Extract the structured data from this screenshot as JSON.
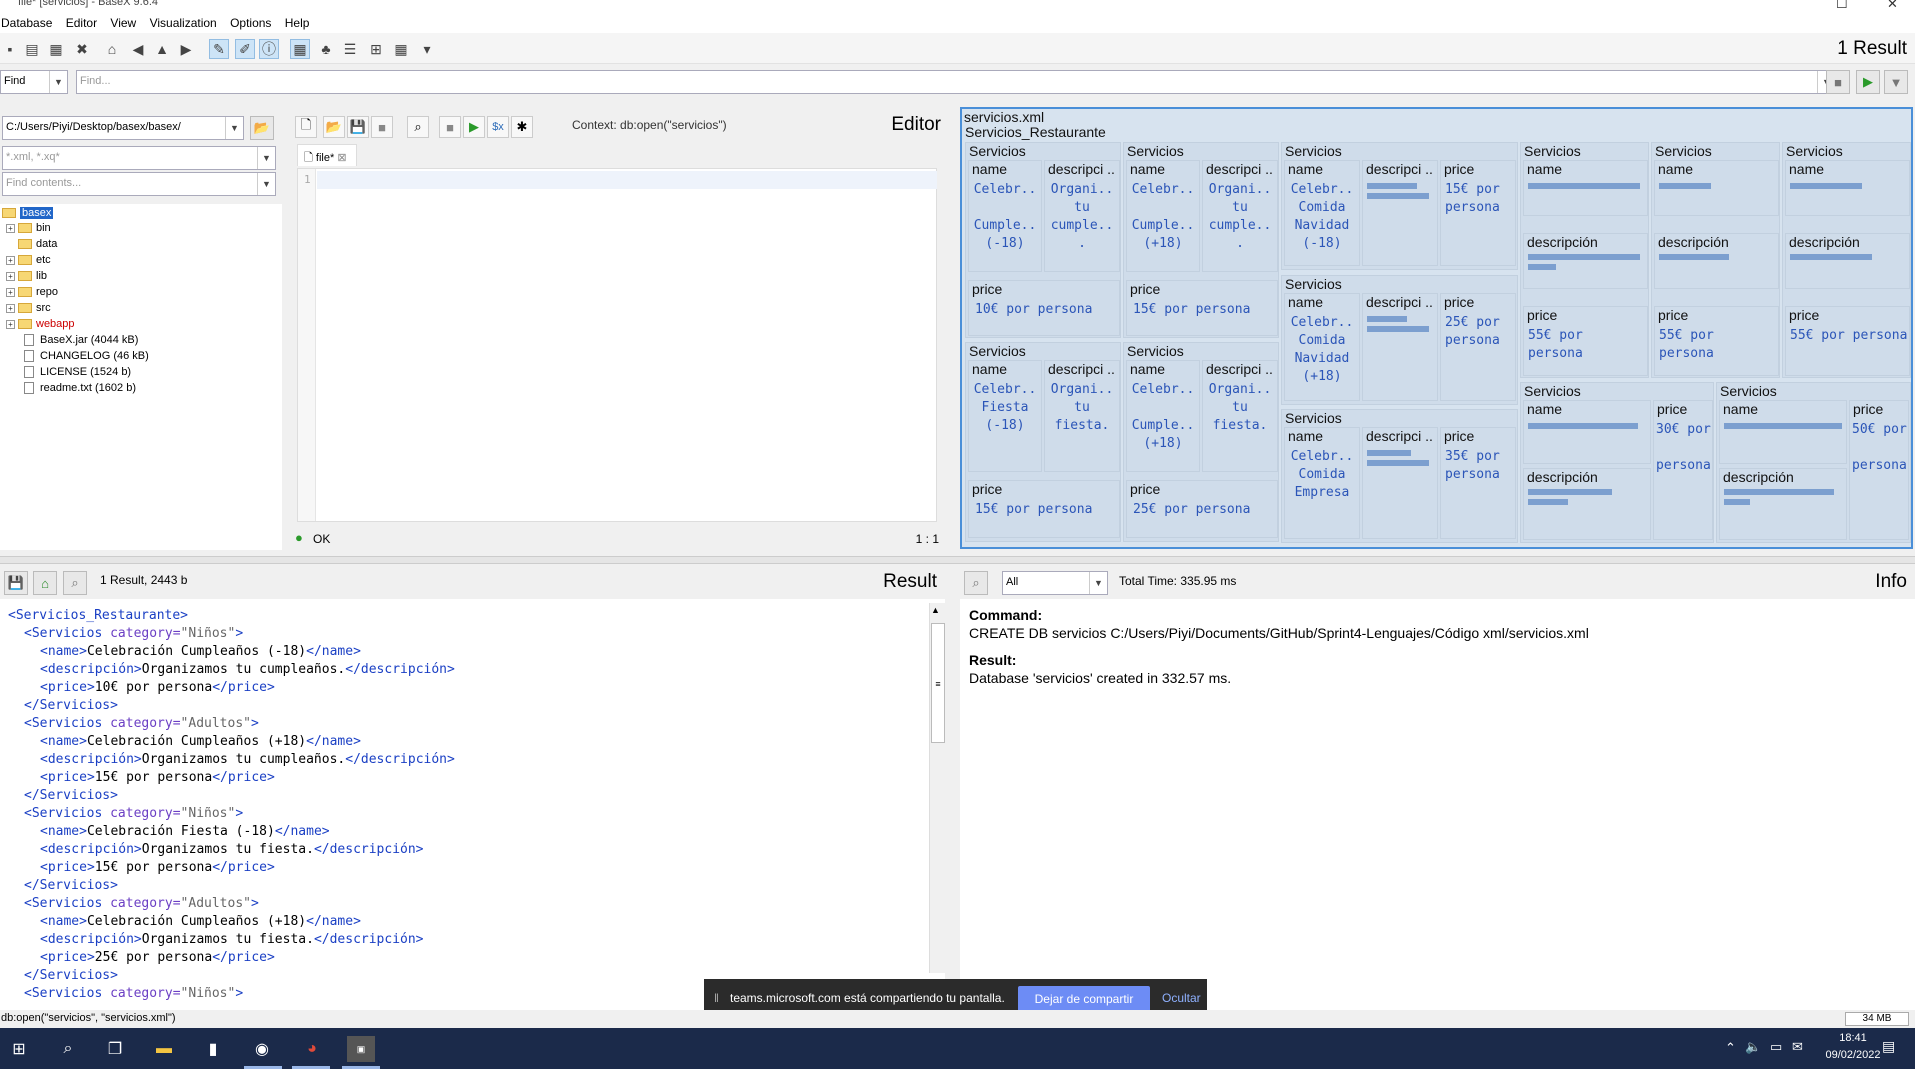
{
  "window": {
    "title": "file* [servicios] - BaseX 9.6.4"
  },
  "menu": [
    "Database",
    "Editor",
    "View",
    "Visualization",
    "Options",
    "Help"
  ],
  "toolbar": {
    "icons": [
      "new-db-icon",
      "open-db-icon",
      "properties-icon",
      "close-icon",
      "home-icon",
      "back-icon",
      "up-icon",
      "forward-icon",
      "filter-icon",
      "xquery-icon",
      "info-icon",
      "map-icon",
      "tree-icon",
      "folder-icon",
      "plot-icon",
      "table-icon",
      "more-icon"
    ],
    "result_count": "1 Result"
  },
  "find": {
    "mode": "Find",
    "placeholder": "Find..."
  },
  "project": {
    "path": "C:/Users/Piyi/Desktop/basex/basex/",
    "filter_placeholder": "*.xml, *.xq*",
    "contents_placeholder": "Find contents...",
    "root": "basex",
    "folders": [
      "bin",
      "data",
      "etc",
      "lib",
      "repo",
      "src",
      "webapp"
    ],
    "files": [
      "BaseX.jar (4044 kB)",
      "CHANGELOG (46 kB)",
      "LICENSE (1524 b)",
      "readme.txt (1602 b)"
    ]
  },
  "editor": {
    "context": "Context: db:open(\"servicios\")",
    "title": "Editor",
    "tab": "file*",
    "line": "1",
    "status": "OK",
    "position": "1 : 1"
  },
  "map": {
    "root": "servicios.xml",
    "container": "Servicios_Restaurante",
    "servicios": "Servicios",
    "name": "name",
    "descripcion_short": "descripci ..",
    "descripcion": "descripción",
    "price": "price",
    "items": [
      {
        "name": "Celebr..\n\nCumple..\n(-18)",
        "desc": "Organi..\ntu\ncumple..\n.",
        "price": "10€ por persona"
      },
      {
        "name": "Celebr..\n\nCumple..\n(+18)",
        "desc": "Organi..\ntu\ncumple..\n.",
        "price": "15€ por persona"
      },
      {
        "name": "Celebr..\nFiesta\n(-18)",
        "desc": "Organi..\ntu\nfiesta.",
        "price": "15€ por persona"
      },
      {
        "name": "Celebr..\n\nCumple..\n(+18)",
        "desc": "Organi..\ntu\nfiesta.",
        "price": "25€ por persona"
      },
      {
        "name": "Celebr..\nComida\nNavidad\n(-18)",
        "price": "15€ por\npersona"
      },
      {
        "name": "Celebr..\nComida\nNavidad\n(+18)",
        "price": "25€ por\npersona"
      },
      {
        "name": "Celebr..\nComida\nEmpresa",
        "price": "35€ por\npersona"
      },
      {
        "price": "55€ por\npersona"
      },
      {
        "price": "55€ por\npersona"
      },
      {
        "price": "55€ por persona"
      },
      {
        "price": "30€ por\n\npersona"
      },
      {
        "price": "50€ por\n\npersona"
      }
    ]
  },
  "result": {
    "summary": "1 Result, 2443 b",
    "title": "Result",
    "lines": [
      {
        "i": 0,
        "t": "<Servicios_Restaurante>"
      },
      {
        "i": 1,
        "open": "Servicios",
        "cat": "Niños"
      },
      {
        "i": 2,
        "tag": "name",
        "v": "Celebración Cumpleaños (-18)"
      },
      {
        "i": 2,
        "tag": "descripción",
        "v": "Organizamos tu cumpleaños."
      },
      {
        "i": 2,
        "tag": "price",
        "v": "10€ por persona"
      },
      {
        "i": 1,
        "t": "</Servicios>"
      },
      {
        "i": 1,
        "open": "Servicios",
        "cat": "Adultos"
      },
      {
        "i": 2,
        "tag": "name",
        "v": "Celebración Cumpleaños (+18)"
      },
      {
        "i": 2,
        "tag": "descripción",
        "v": "Organizamos tu cumpleaños."
      },
      {
        "i": 2,
        "tag": "price",
        "v": "15€ por persona"
      },
      {
        "i": 1,
        "t": "</Servicios>"
      },
      {
        "i": 1,
        "open": "Servicios",
        "cat": "Niños"
      },
      {
        "i": 2,
        "tag": "name",
        "v": "Celebración Fiesta (-18)"
      },
      {
        "i": 2,
        "tag": "descripción",
        "v": "Organizamos tu fiesta."
      },
      {
        "i": 2,
        "tag": "price",
        "v": "15€ por persona"
      },
      {
        "i": 1,
        "t": "</Servicios>"
      },
      {
        "i": 1,
        "open": "Servicios",
        "cat": "Adultos"
      },
      {
        "i": 2,
        "tag": "name",
        "v": "Celebración Cumpleaños (+18)"
      },
      {
        "i": 2,
        "tag": "descripción",
        "v": "Organizamos tu fiesta."
      },
      {
        "i": 2,
        "tag": "price",
        "v": "25€ por persona"
      },
      {
        "i": 1,
        "t": "</Servicios>"
      },
      {
        "i": 1,
        "open": "Servicios",
        "cat": "Niños"
      }
    ]
  },
  "info": {
    "filter": "All",
    "total_time": "Total Time: 335.95 ms",
    "title": "Info",
    "command_label": "Command:",
    "command": "CREATE DB servicios C:/Users/Piyi/Documents/GitHub/Sprint4-Lenguajes/Código xml/servicios.xml",
    "result_label": "Result:",
    "result": "Database 'servicios' created in 332.57 ms."
  },
  "status": {
    "query": "db:open(\"servicios\", \"servicios.xml\")",
    "memory": "34 MB"
  },
  "teams": {
    "message": "teams.microsoft.com está compartiendo tu pantalla.",
    "stop": "Dejar de compartir",
    "hide": "Ocultar"
  },
  "taskbar": {
    "time": "18:41",
    "date": "09/02/2022"
  }
}
